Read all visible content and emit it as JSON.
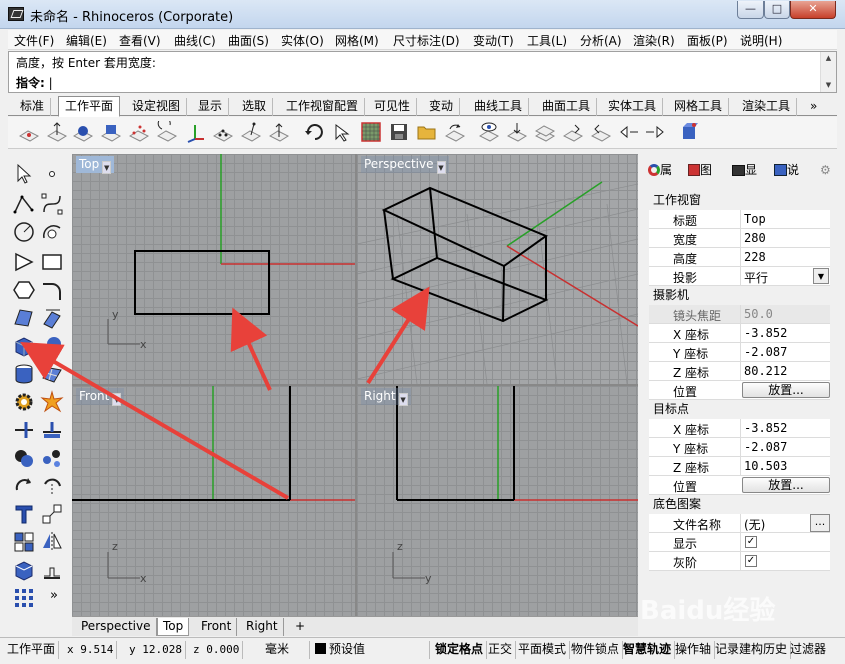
{
  "window": {
    "title": "未命名 - Rhinoceros (Corporate)",
    "min": "—",
    "max": "□",
    "close": "✕"
  },
  "menu": [
    "文件(F)",
    "编辑(E)",
    "查看(V)",
    "曲线(C)",
    "曲面(S)",
    "实体(O)",
    "网格(M)",
    "尺寸标注(D)",
    "变动(T)",
    "工具(L)",
    "分析(A)",
    "渲染(R)",
    "面板(P)",
    "说明(H)"
  ],
  "command": {
    "history": "高度，按 Enter 套用宽度:",
    "prompt": "指令:",
    "scroll_up": "▲",
    "scroll_down": "▼"
  },
  "toolbar_tabs": [
    "标准",
    "工作平面",
    "设定视图",
    "显示",
    "选取",
    "工作视窗配置",
    "可见性",
    "变动",
    "曲线工具",
    "曲面工具",
    "实体工具",
    "网格工具",
    "渲染工具"
  ],
  "toolbar_more": "»",
  "viewports": {
    "top": "Top",
    "perspective": "Perspective",
    "front": "Front",
    "right": "Right",
    "dropdown": "▼"
  },
  "axis": {
    "x": "x",
    "y": "y",
    "z": "z"
  },
  "viewport_tabs": [
    "Perspective",
    "Top",
    "Front",
    "Right"
  ],
  "viewport_tab_add": "+",
  "left_more": "»",
  "panel_tabs": [
    "属",
    "图",
    "显",
    "说"
  ],
  "properties": {
    "viewport_section": "工作视窗",
    "title_k": "标题",
    "title_v": "Top",
    "width_k": "宽度",
    "width_v": "280",
    "height_k": "高度",
    "height_v": "228",
    "proj_k": "投影",
    "proj_v": "平行",
    "camera_section": "摄影机",
    "lens_k": "镜头焦距",
    "lens_v": "50.0",
    "cx_k": "X 座标",
    "cx_v": "-3.852",
    "cy_k": "Y 座标",
    "cy_v": "-2.087",
    "cz_k": "Z 座标",
    "cz_v": "80.212",
    "pos_k": "位置",
    "pos_btn": "放置...",
    "target_section": "目标点",
    "tx_k": "X 座标",
    "tx_v": "-3.852",
    "ty_k": "Y 座标",
    "ty_v": "-2.087",
    "tz_k": "Z 座标",
    "tz_v": "10.503",
    "tpos_k": "位置",
    "tpos_btn": "放置...",
    "wallpaper_section": "底色图案",
    "file_k": "文件名称",
    "file_v": "(无)",
    "file_btn": "...",
    "show_k": "显示",
    "gray_k": "灰阶",
    "check": "✓"
  },
  "status": {
    "cplane": "工作平面",
    "x": "x 9.514",
    "y": "y 12.028",
    "z": "z 0.000",
    "unit": "毫米",
    "layer": "预设值",
    "grid_snap": "锁定格点",
    "ortho": "正交",
    "planar": "平面模式",
    "osnap": "物件锁点",
    "smart": "智慧轨迹",
    "gumball": "操作轴",
    "history": "记录建构历史",
    "filter": "过滤器"
  },
  "watermark": "Baidu经验",
  "colors": {
    "title_grad": "#c3d6ee",
    "axis_red": "#c83030",
    "axis_green": "#28a028",
    "arrow": "#e8413a",
    "viewport_bg": "#9ea0a2"
  }
}
